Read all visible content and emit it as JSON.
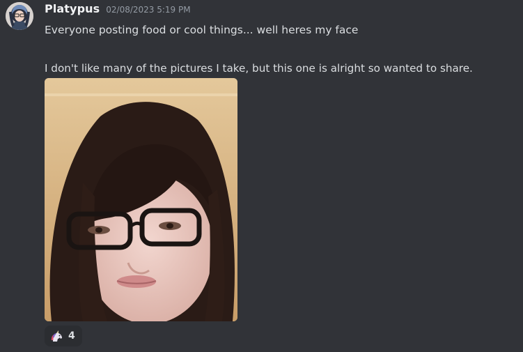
{
  "message": {
    "author": {
      "username": "Platypus",
      "avatar_icon": "user-avatar-icon"
    },
    "timestamp": "02/08/2023 5:19 PM",
    "lines": [
      "Everyone posting food or cool things... well heres my face",
      "I don't like many of the pictures I take, but this one is alright so wanted to share."
    ],
    "attachment": {
      "type": "image",
      "icon": "selfie-photo"
    },
    "reactions": [
      {
        "emoji_icon": "unicorn-emoji-icon",
        "count": "4"
      }
    ]
  },
  "colors": {
    "background": "#313338",
    "text": "#dbdee1",
    "username": "#f2f3f5",
    "timestamp": "#949ba4",
    "reaction_bg": "#2b2d31"
  }
}
